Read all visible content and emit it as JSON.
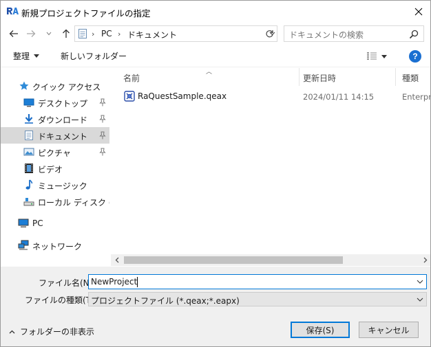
{
  "window": {
    "title": "新規プロジェクトファイルの指定",
    "close_glyph": "✕"
  },
  "address": {
    "crumbs": [
      "PC",
      "ドキュメント"
    ]
  },
  "search": {
    "placeholder": "ドキュメントの検索"
  },
  "toolbar": {
    "organize_label": "整理",
    "new_folder_label": "新しいフォルダー"
  },
  "sidebar": {
    "items": [
      {
        "label": "クイック アクセス"
      },
      {
        "label": "デスクトップ"
      },
      {
        "label": "ダウンロード"
      },
      {
        "label": "ドキュメント"
      },
      {
        "label": "ピクチャ"
      },
      {
        "label": "ビデオ"
      },
      {
        "label": "ミュージック"
      },
      {
        "label": "ローカル ディスク (C:)"
      },
      {
        "label": "PC"
      },
      {
        "label": "ネットワーク"
      }
    ]
  },
  "file_list": {
    "columns": [
      "名前",
      "更新日時",
      "種類"
    ],
    "rows": [
      {
        "name": "RaQuestSample.qeax",
        "modified": "2024/01/11 14:15",
        "type": "Enterpri"
      }
    ]
  },
  "bottom": {
    "filename_label": "ファイル名(N):",
    "filename_value": "NewProject",
    "filetype_label": "ファイルの種類(T):",
    "filetype_value": "プロジェクトファイル (*.qeax;*.eapx)",
    "hide_folders_label": "フォルダーの非表示",
    "save_label": "保存(S)",
    "cancel_label": "キャンセル"
  },
  "colors": {
    "accent": "#0078d7",
    "selection": "#d9d9d9",
    "help": "#1a6fd1"
  }
}
